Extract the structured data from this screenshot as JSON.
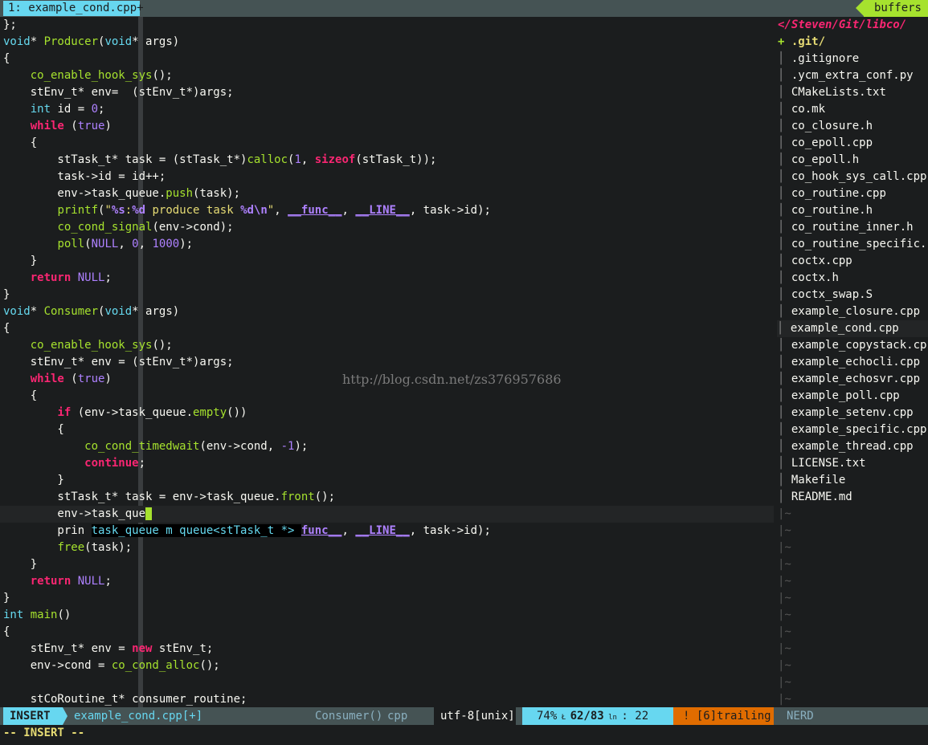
{
  "tabbar": {
    "active_tab": "1: example_cond.cpp+",
    "buffers_label": "buffers"
  },
  "editor": {
    "watermark": "http://blog.csdn.net/zs376957686",
    "lines": [
      "};",
      "void* Producer(void* args)",
      "{",
      "    co_enable_hook_sys();",
      "    stEnv_t* env=  (stEnv_t*)args;",
      "    int id = 0;",
      "    while (true)",
      "    {",
      "        stTask_t* task = (stTask_t*)calloc(1, sizeof(stTask_t));",
      "        task->id = id++;",
      "        env->task_queue.push(task);",
      "        printf(\"%s:%d produce task %d\\n\", __func__, __LINE__, task->id);",
      "        co_cond_signal(env->cond);",
      "        poll(NULL, 0, 1000);",
      "    }",
      "    return NULL;",
      "}",
      "void* Consumer(void* args)",
      "{",
      "    co_enable_hook_sys();",
      "    stEnv_t* env = (stEnv_t*)args;",
      "    while (true)",
      "    {",
      "        if (env->task_queue.empty())",
      "        {",
      "            co_cond_timedwait(env->cond, -1);",
      "            continue;",
      "        }",
      "        stTask_t* task = env->task_queue.front();",
      "        env->task_que",
      "        prin task_queue m queue<stTask_t *> func__, __LINE__, task->id);",
      "        free(task);",
      "    }",
      "    return NULL;",
      "}",
      "int main()",
      "{",
      "    stEnv_t* env = new stEnv_t;",
      "    env->cond = co_cond_alloc();",
      "",
      "    stCoRoutine_t* consumer_routine;"
    ]
  },
  "nerdtree": {
    "root": "</Steven/Git/libco/",
    "dir_marker": "+",
    "git_dir": ".git/",
    "files": [
      ".gitignore",
      ".ycm_extra_conf.py",
      "CMakeLists.txt",
      "co.mk",
      "co_closure.h",
      "co_epoll.cpp",
      "co_epoll.h",
      "co_hook_sys_call.cpp",
      "co_routine.cpp",
      "co_routine.h",
      "co_routine_inner.h",
      "co_routine_specific.",
      "coctx.cpp",
      "coctx.h",
      "coctx_swap.S",
      "example_closure.cpp",
      "example_cond.cpp",
      "example_copystack.cp",
      "example_echocli.cpp",
      "example_echosvr.cpp",
      "example_poll.cpp",
      "example_setenv.cpp",
      "example_specific.cpp",
      "example_thread.cpp",
      "LICENSE.txt",
      "Makefile",
      "README.md"
    ],
    "selected_file": "example_cond.cpp"
  },
  "statusbar": {
    "mode": "INSERT",
    "file": "example_cond.cpp[+]",
    "function": "Consumer()",
    "filetype": "cpp",
    "encoding": "utf-8[unix]",
    "percent": "74%",
    "position": "62/83",
    "column": ": 22",
    "warning": "! [6]trailing",
    "nerd": "NERD"
  },
  "cmdline": "-- INSERT --"
}
